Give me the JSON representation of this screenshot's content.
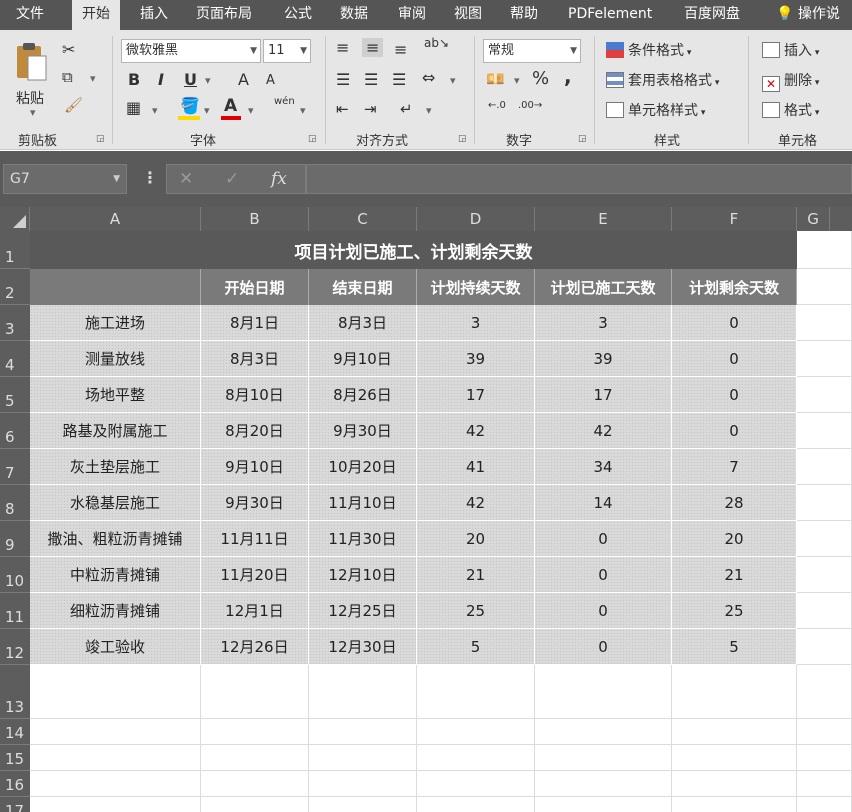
{
  "tabs": [
    "文件",
    "开始",
    "插入",
    "页面布局",
    "公式",
    "数据",
    "审阅",
    "视图",
    "帮助",
    "PDFelement",
    "百度网盘",
    "操作说"
  ],
  "active_tab": "开始",
  "ribbon": {
    "clipboard": {
      "paste_label": "粘贴",
      "group_label": "剪贴板"
    },
    "font": {
      "font_name": "微软雅黑",
      "font_size": "11",
      "group_label": "字体",
      "bold": "B",
      "italic": "I",
      "underline": "U",
      "grow": "A",
      "shrink": "A",
      "phonetic": "wén",
      "fill_color": "#ffd800",
      "font_color": "#e00000"
    },
    "alignment": {
      "group_label": "对齐方式"
    },
    "number": {
      "format": "常规",
      "group_label": "数字",
      "percent": "%",
      "comma": ","
    },
    "styles": {
      "conditional": "条件格式",
      "table_style": "套用表格格式",
      "cell_style": "单元格样式",
      "group_label": "样式"
    },
    "cells": {
      "insert": "插入",
      "delete": "删除",
      "format": "格式",
      "group_label": "单元格"
    }
  },
  "formula_bar": {
    "name_box": "G7",
    "cancel": "✕",
    "enter": "✓",
    "fx": "fx",
    "value": ""
  },
  "columns": [
    "A",
    "B",
    "C",
    "D",
    "E",
    "F",
    "G"
  ],
  "rows": [
    "1",
    "2",
    "3",
    "4",
    "5",
    "6",
    "7",
    "8",
    "9",
    "10",
    "11",
    "12",
    "13",
    "14",
    "15",
    "16",
    "17"
  ],
  "sheet": {
    "title": "项目计划已施工、计划剩余天数",
    "headers": [
      "",
      "开始日期",
      "结束日期",
      "计划持续天数",
      "计划已施工天数",
      "计划剩余天数"
    ],
    "data": [
      [
        "施工进场",
        "8月1日",
        "8月3日",
        "3",
        "3",
        "0"
      ],
      [
        "测量放线",
        "8月3日",
        "9月10日",
        "39",
        "39",
        "0"
      ],
      [
        "场地平整",
        "8月10日",
        "8月26日",
        "17",
        "17",
        "0"
      ],
      [
        "路基及附属施工",
        "8月20日",
        "9月30日",
        "42",
        "42",
        "0"
      ],
      [
        "灰土垫层施工",
        "9月10日",
        "10月20日",
        "41",
        "34",
        "7"
      ],
      [
        "水稳基层施工",
        "9月30日",
        "11月10日",
        "42",
        "14",
        "28"
      ],
      [
        "撒油、粗粒沥青摊铺",
        "11月11日",
        "11月30日",
        "20",
        "0",
        "20"
      ],
      [
        "中粒沥青摊铺",
        "11月20日",
        "12月10日",
        "21",
        "0",
        "21"
      ],
      [
        "细粒沥青摊铺",
        "12月1日",
        "12月25日",
        "25",
        "0",
        "25"
      ],
      [
        "竣工验收",
        "12月26日",
        "12月30日",
        "5",
        "0",
        "5"
      ]
    ]
  }
}
